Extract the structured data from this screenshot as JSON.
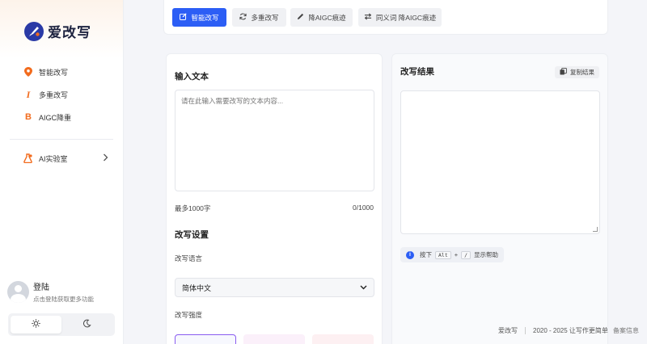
{
  "sidebar": {
    "logo_text": "爱改写",
    "items": [
      {
        "label": "智能改写",
        "icon": "location-pin-icon"
      },
      {
        "label": "多重改写",
        "icon": "italic-i-icon"
      },
      {
        "label": "AIGC降重",
        "icon": "bold-b-icon"
      },
      {
        "label": "AI实验室",
        "icon": "flask-lab-icon"
      }
    ],
    "user": {
      "name": "登陆",
      "hint": "点击登陆获取更多功能"
    },
    "theme": {
      "light_icon": "sun-icon",
      "dark_icon": "moon-icon"
    }
  },
  "tabs": [
    {
      "label": "智能改写",
      "icon": "edit-icon"
    },
    {
      "label": "多重改写",
      "icon": "refresh-icon"
    },
    {
      "label": "降AIGC痕迹",
      "icon": "pen-icon"
    },
    {
      "label": "同义词 降AIGC痕迹",
      "icon": "swap-icon"
    }
  ],
  "input": {
    "title": "输入文本",
    "placeholder": "请在此输入需要改写的文本内容...",
    "limit_label": "最多1000字",
    "counter": "0/1000"
  },
  "settings": {
    "title": "改写设置",
    "language_label": "改写语言",
    "language_value": "简体中文",
    "strength_label": "改写强度"
  },
  "result": {
    "title": "改写结果",
    "copy_label": "复制结果",
    "help_prefix": "按下",
    "key1": "Alt",
    "plus": "+",
    "key2": "/",
    "help_suffix": "显示帮助"
  },
  "footer": {
    "brand": "爱改写",
    "copyright": "2020 - 2025 让写作更简单",
    "record": "备案信息"
  },
  "colors": {
    "accent": "#2c5ef5",
    "brand_orange": "#f26b1d",
    "logo_blue": "#2a3aa6"
  }
}
